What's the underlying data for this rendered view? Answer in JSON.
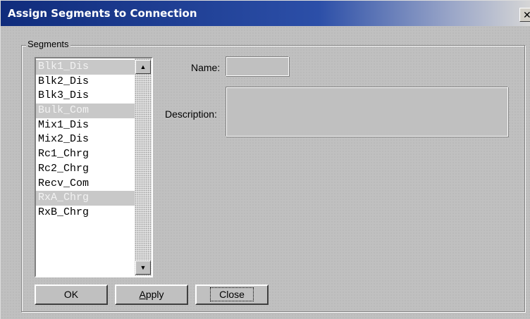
{
  "window": {
    "title": "Assign Segments to Connection",
    "close_glyph": "✕"
  },
  "group": {
    "label": "Segments"
  },
  "segments": {
    "items": [
      {
        "label": "Blk1_Dis",
        "selected": true
      },
      {
        "label": "Blk2_Dis",
        "selected": false
      },
      {
        "label": "Blk3_Dis",
        "selected": false
      },
      {
        "label": "Bulk_Com",
        "selected": true
      },
      {
        "label": "Mix1_Dis",
        "selected": false
      },
      {
        "label": "Mix2_Dis",
        "selected": false
      },
      {
        "label": "Rc1_Chrg",
        "selected": false
      },
      {
        "label": "Rc2_Chrg",
        "selected": false
      },
      {
        "label": "Recv_Com",
        "selected": false
      },
      {
        "label": "RxA_Chrg",
        "selected": true
      },
      {
        "label": "RxB_Chrg",
        "selected": false
      }
    ],
    "scroll_up_icon": "up-arrow-icon",
    "scroll_down_icon": "down-arrow-icon"
  },
  "form": {
    "name_label": "Name:",
    "name_value": "",
    "description_label": "Description:",
    "description_value": ""
  },
  "buttons": {
    "ok": "OK",
    "apply_first": "A",
    "apply_rest": "pply",
    "close": "Close"
  }
}
